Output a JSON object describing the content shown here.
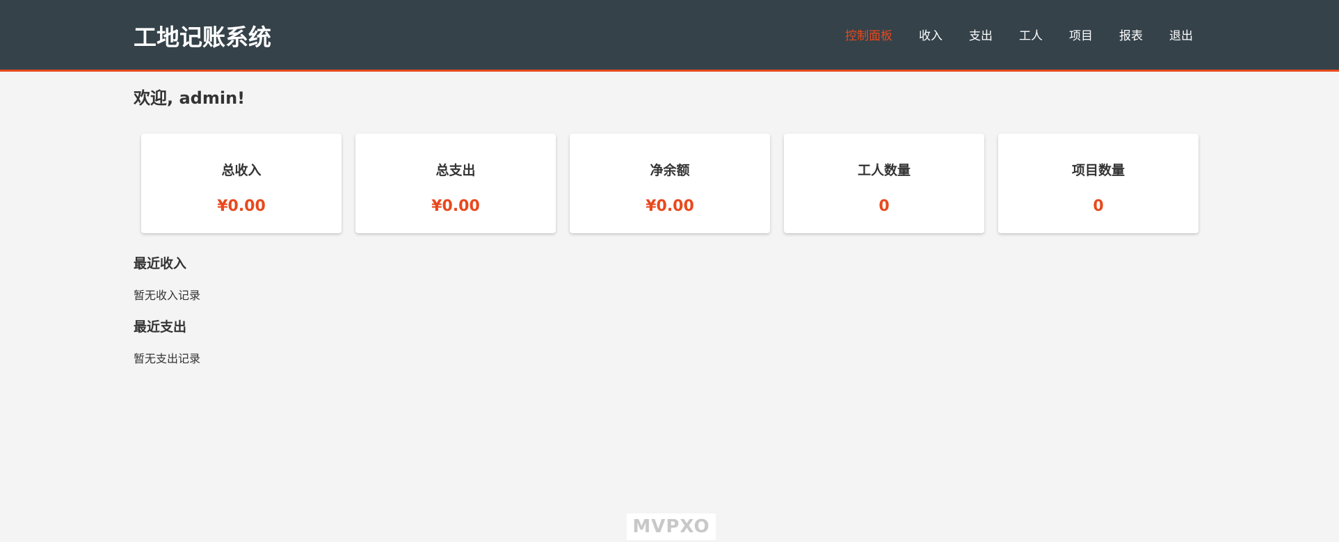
{
  "app": {
    "title": "工地记账系统"
  },
  "nav": {
    "items": [
      {
        "label": "控制面板",
        "active": true
      },
      {
        "label": "收入",
        "active": false
      },
      {
        "label": "支出",
        "active": false
      },
      {
        "label": "工人",
        "active": false
      },
      {
        "label": "项目",
        "active": false
      },
      {
        "label": "报表",
        "active": false
      },
      {
        "label": "退出",
        "active": false
      }
    ]
  },
  "welcome": {
    "text": "欢迎, admin!"
  },
  "stats": [
    {
      "label": "总收入",
      "value": "¥0.00"
    },
    {
      "label": "总支出",
      "value": "¥0.00"
    },
    {
      "label": "净余额",
      "value": "¥0.00"
    },
    {
      "label": "工人数量",
      "value": "0"
    },
    {
      "label": "项目数量",
      "value": "0"
    }
  ],
  "recent_income": {
    "title": "最近收入",
    "empty_text": "暂无收入记录"
  },
  "recent_expense": {
    "title": "最近支出",
    "empty_text": "暂无支出记录"
  },
  "watermark": {
    "text": "MVPXO"
  },
  "colors": {
    "header_bg": "#35424a",
    "accent": "#e8491d",
    "page_bg": "#f4f4f4"
  }
}
